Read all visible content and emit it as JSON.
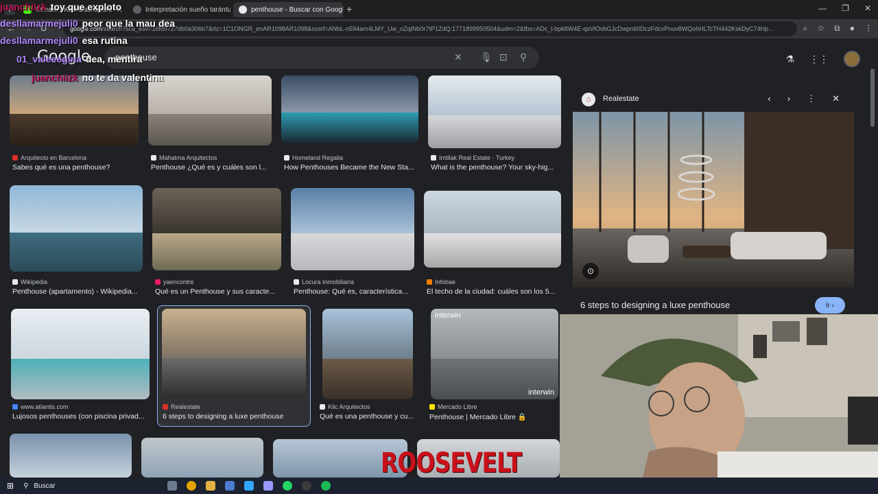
{
  "tabs": [
    {
      "title": "Stream - Kick Dashboard",
      "color": "#53fc18"
    },
    {
      "title": "Interpretación sueño tarántula",
      "color": "#9aa0a6"
    },
    {
      "title": "penthouse - Buscar con Google",
      "color": "#e8eaed"
    }
  ],
  "address": {
    "host": "google.com",
    "rest": "/search?sca_esv=16fd9727db0a306b7&rlz=1C1ONGR_enAR1098AR1098&sxsrf=ANbL-n594am4LMY_Uw_oZqINb0r7tP1ZdQ:1771899950504&udm=2&fbs=ADc_l-bpk8W4E-qsVlOvbGJcDwpn60DczFdcvPnuv8WQohHLTcTH442KskDyC74Hp..."
  },
  "search": {
    "query": "penthouse"
  },
  "chat": [
    {
      "user": "juanchiizk",
      "message": "toy que exploto",
      "color": "#c2185b"
    },
    {
      "user": "desllamarmejuli0",
      "message": "peor que la mau dea",
      "color": "#b388ff"
    },
    {
      "user": "desllamarmejuli0",
      "message": "esa rutina",
      "color": "#b388ff"
    },
    {
      "user": "01_valeeegina",
      "message": "dea, mentira",
      "color": "#b388ff"
    },
    {
      "user": "juanchiizk",
      "message": "no te da valentina",
      "color": "#c2185b"
    }
  ],
  "results": [
    {
      "source": "Arquitecto en Barcelona",
      "title": "Sabes qué es una penthouse?",
      "fav": "#d93025"
    },
    {
      "source": "Mahatma Arquitectos",
      "title": "Penthouse ¿Qué es y cuáles son l...",
      "fav": "#e8eaed"
    },
    {
      "source": "Homeland Regalia",
      "title": "How Penthouses Became the New Sta...",
      "fav": "#e8eaed"
    },
    {
      "source": "Imtilak Real Estate - Turkey",
      "title": "What is the penthouse? Your sky-hig...",
      "fav": "#e8eaed"
    },
    {
      "source": "Wikipedia",
      "title": "Penthouse (apartamento) - Wikipedia...",
      "fav": "#e8eaed"
    },
    {
      "source": "yaencontre",
      "title": "Qué es un Penthouse y sus caracte...",
      "fav": "#e91e63"
    },
    {
      "source": "Locura Inmobiliaria",
      "title": "Penthouse: Qué es, característica...",
      "fav": "#e8eaed"
    },
    {
      "source": "Infobae",
      "title": "El techo de la ciudad: cuáles son los 5...",
      "fav": "#f57c00"
    },
    {
      "source": "www.atlantis.com",
      "title": "Lujosos penthouses (con piscina privad...",
      "fav": "#4285f4"
    },
    {
      "source": "Realestate",
      "title": "6 steps to designing a luxe penthouse",
      "fav": "#d93025"
    },
    {
      "source": "Klic Arquitectos",
      "title": "Qué es una penthouse y cu...",
      "fav": "#e8eaed"
    },
    {
      "source": "Mercado Libre",
      "title": "Penthouse | Mercado Libre",
      "fav": "#ffe600"
    }
  ],
  "panel": {
    "source": "Realestate",
    "title": "6 steps to designing a luxe penthouse",
    "go_label": "Ir"
  },
  "watermarks": {
    "interwin": "interwin",
    "overlay": "ROOSEVELT"
  },
  "taskbar": {
    "search_label": "Buscar"
  }
}
